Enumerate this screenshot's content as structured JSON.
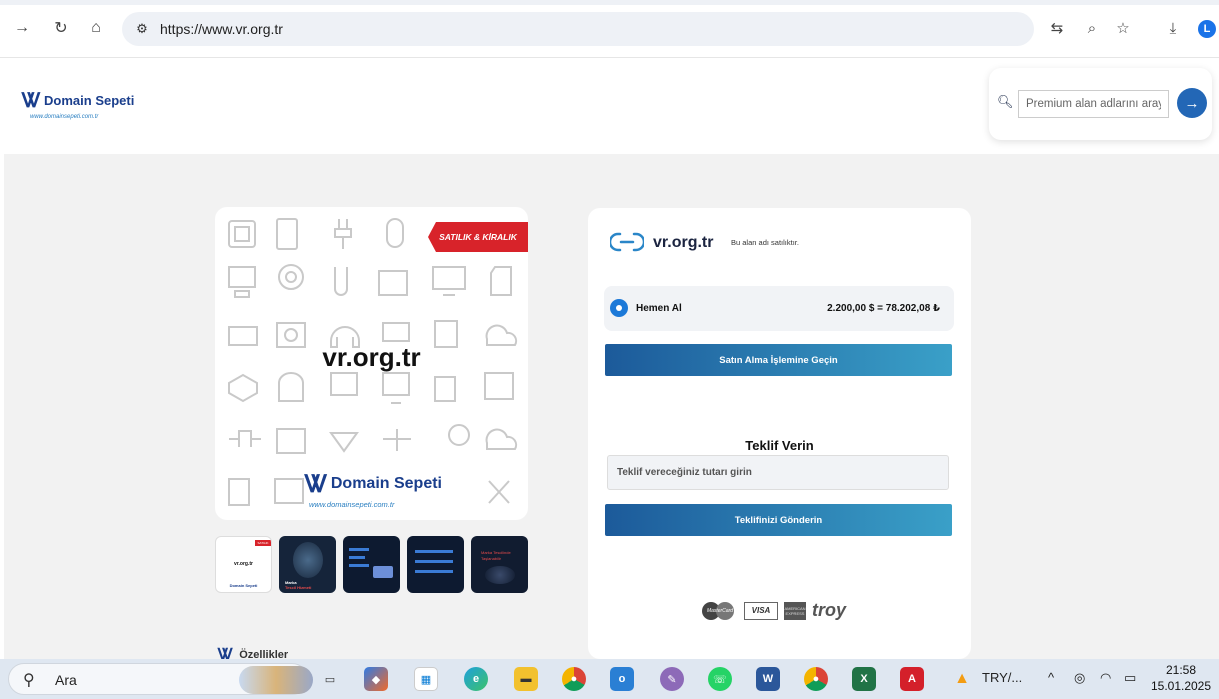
{
  "browser": {
    "url": "https://www.vr.org.tr",
    "profile_initial": "L"
  },
  "site": {
    "logo_name": "Domain Sepeti",
    "logo_url": "www.domainsepeti.com.tr",
    "search_placeholder": "Premium alan adlarını arayın"
  },
  "listing": {
    "ribbon": "SATILIK & KİRALIK",
    "domain": "vr.org.tr",
    "note": "Bu alan adı satılıktır.",
    "buy_label": "Hemen Al",
    "price": "2.200,00 $ = 78.202,08 ₺",
    "buy_button": "Satın Alma İşlemine Geçin",
    "offer_title": "Teklif Verin",
    "offer_placeholder": "Teklif vereceğiniz tutarı girin",
    "offer_button": "Teklifinizi Gönderin",
    "features_label": "Özellikler"
  },
  "thumbnails": {
    "t1_domain": "vr.org.tr",
    "t1_ribbon": "SATILIK",
    "t2_line1": "Marka",
    "t2_line2": "Tescil Hizmeti",
    "t5_line1": "Marka Tescilinde",
    "t5_line2": "Taşlanabilir"
  },
  "payments": {
    "mastercard": "MasterCard",
    "visa": "VISA",
    "amex": "AMERICAN EXPRESS",
    "troy": "troy"
  },
  "taskbar": {
    "search_text": "Ara",
    "currency": "TRY/...",
    "time": "21:58",
    "date": "15.01.2025"
  }
}
